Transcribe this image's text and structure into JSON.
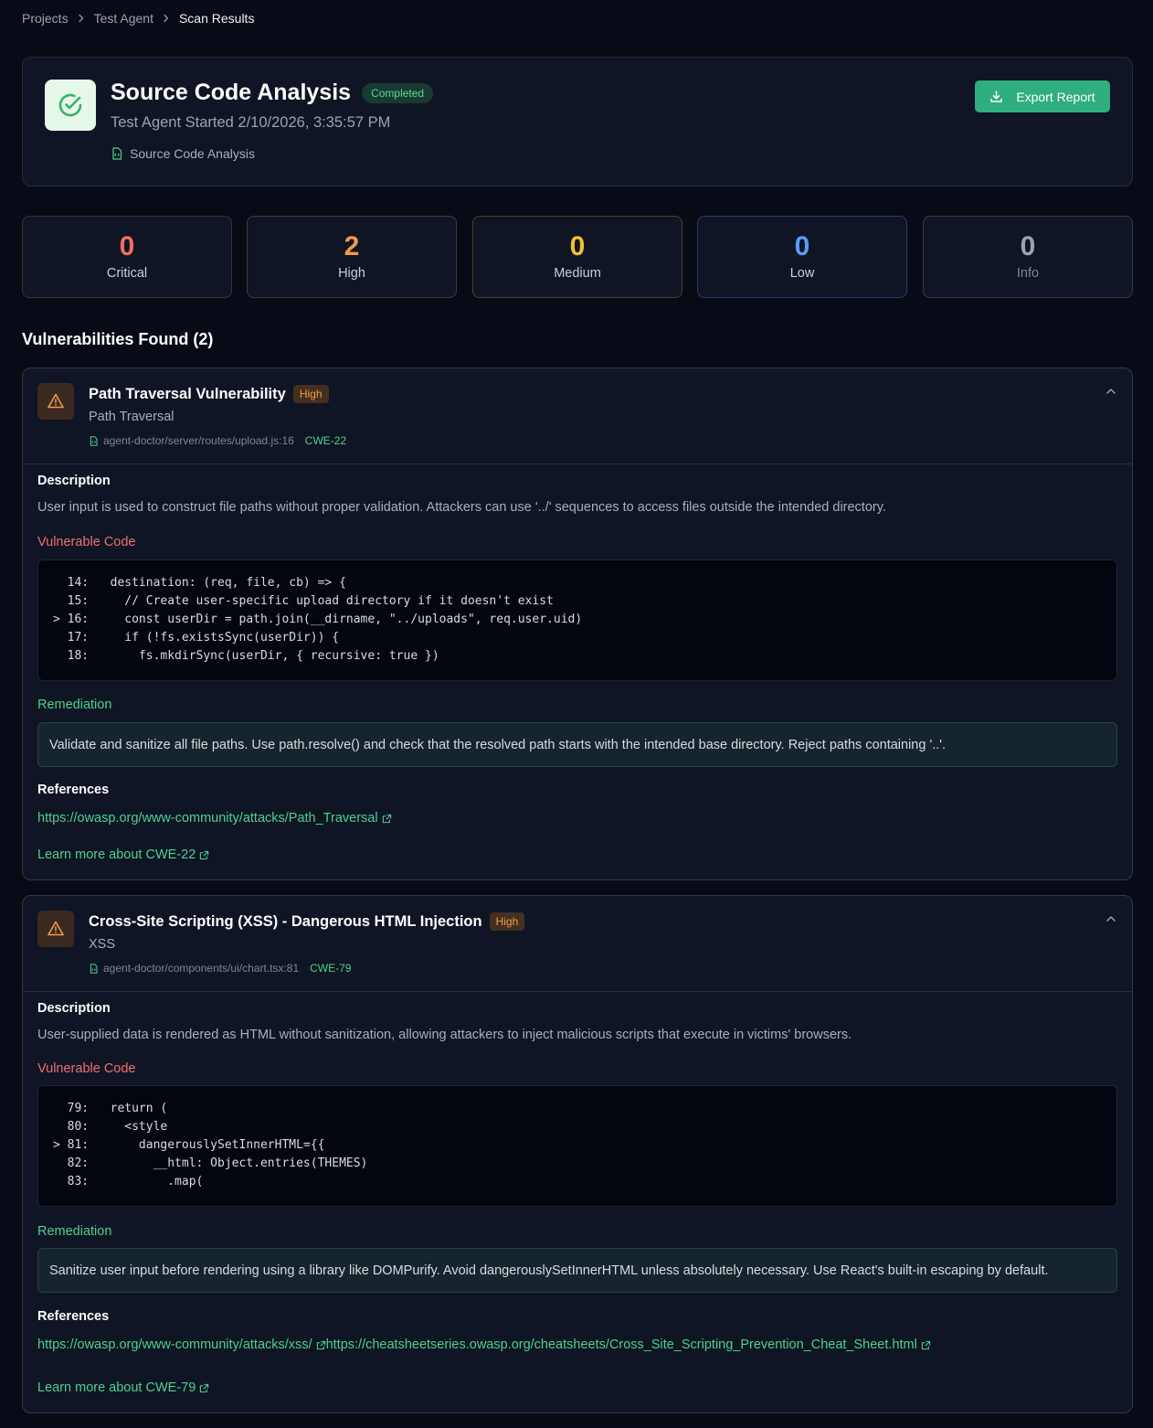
{
  "breadcrumb": [
    "Projects",
    "Test Agent",
    "Scan Results"
  ],
  "header": {
    "title": "Source Code Analysis",
    "status": "Completed",
    "subtitle": "Test Agent Started 2/10/2026, 3:35:57 PM",
    "scan_type": "Source Code Analysis",
    "export_label": "Export Report"
  },
  "stats": [
    {
      "count": "0",
      "label": "Critical",
      "color": "#ef6f5f",
      "border": "#4a2a30"
    },
    {
      "count": "2",
      "label": "High",
      "color": "#f19a4c",
      "border": "#4b3a2c"
    },
    {
      "count": "0",
      "label": "Medium",
      "color": "#f3c02e",
      "border": "#4a4224"
    },
    {
      "count": "0",
      "label": "Low",
      "color": "#5b9cf6",
      "border": "#2a3b6e"
    },
    {
      "count": "0",
      "label": "Info",
      "color": "#9aa3b2",
      "border": "#333b4b"
    }
  ],
  "section_title": "Vulnerabilities Found (2)",
  "labels": {
    "description": "Description",
    "vulnerable_code": "Vulnerable Code",
    "remediation": "Remediation",
    "references": "References"
  },
  "vulnerabilities": [
    {
      "title": "Path Traversal Vulnerability",
      "severity": "High",
      "category": "Path Traversal",
      "file": "agent-doctor/server/routes/upload.js:16",
      "cwe": "CWE-22",
      "description": "User input is used to construct file paths without proper validation. Attackers can use '../' sequences to access files outside the intended directory.",
      "code": [
        "  14:   destination: (req, file, cb) => {",
        "  15:     // Create user-specific upload directory if it doesn't exist",
        "> 16:     const userDir = path.join(__dirname, \"../uploads\", req.user.uid)",
        "  17:     if (!fs.existsSync(userDir)) {",
        "  18:       fs.mkdirSync(userDir, { recursive: true })"
      ],
      "remediation": "Validate and sanitize all file paths. Use path.resolve() and check that the resolved path starts with the intended base directory. Reject paths containing '..'.",
      "references": [
        "https://owasp.org/www-community/attacks/Path_Traversal"
      ],
      "learn_more": "Learn more about CWE-22"
    },
    {
      "title": "Cross-Site Scripting (XSS) - Dangerous HTML Injection",
      "severity": "High",
      "category": "XSS",
      "file": "agent-doctor/components/ui/chart.tsx:81",
      "cwe": "CWE-79",
      "description": "User-supplied data is rendered as HTML without sanitization, allowing attackers to inject malicious scripts that execute in victims' browsers.",
      "code": [
        "  79:   return (",
        "  80:     <style",
        "> 81:       dangerouslySetInnerHTML={{",
        "  82:         __html: Object.entries(THEMES)",
        "  83:           .map("
      ],
      "remediation": "Sanitize user input before rendering using a library like DOMPurify. Avoid dangerouslySetInnerHTML unless absolutely necessary. Use React's built-in escaping by default.",
      "references": [
        "https://owasp.org/www-community/attacks/xss/",
        "https://cheatsheetseries.owasp.org/cheatsheets/Cross_Site_Scripting_Prevention_Cheat_Sheet.html"
      ],
      "learn_more": "Learn more about CWE-79"
    }
  ]
}
